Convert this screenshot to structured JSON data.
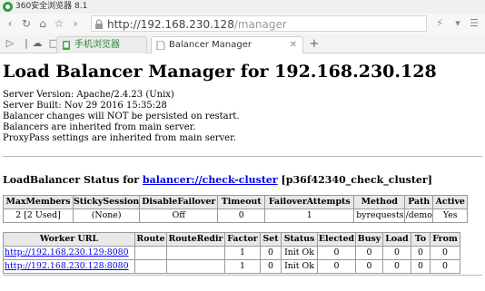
{
  "browser": {
    "app_title": "360安全浏览器 8.1",
    "url_host": "http://192.168.230.128",
    "url_path": "/manager",
    "tabs": [
      {
        "label": "手机浏览器",
        "active": false
      },
      {
        "label": "Balancer Manager",
        "active": true
      }
    ],
    "new_tab_label": "+"
  },
  "page": {
    "title": "Load Balancer Manager for 192.168.230.128",
    "info_lines": [
      "Server Version: Apache/2.4.23 (Unix)",
      "Server Built: Nov 29 2016 15:35:28",
      "Balancer changes will NOT be persisted on restart.",
      "Balancers are inherited from main server.",
      "ProxyPass settings are inherited from main server."
    ],
    "status": {
      "prefix": "LoadBalancer Status for",
      "link": "balancer://check-cluster",
      "suffix": "[p36f42340_check_cluster]"
    },
    "balancer_table": {
      "headers": [
        "MaxMembers",
        "StickySession",
        "DisableFailover",
        "Timeout",
        "FailoverAttempts",
        "Method",
        "Path",
        "Active"
      ],
      "row": [
        "2 [2 Used]",
        "(None)",
        "Off",
        "0",
        "1",
        "byrequests",
        "/demo",
        "Yes"
      ]
    },
    "worker_table": {
      "headers": [
        "Worker URL",
        "Route",
        "RouteRedir",
        "Factor",
        "Set",
        "Status",
        "Elected",
        "Busy",
        "Load",
        "To",
        "From"
      ],
      "rows": [
        [
          "http://192.168.230.129:8080",
          "",
          "",
          "1",
          "0",
          "Init Ok",
          "0",
          "0",
          "0",
          "0",
          "0"
        ],
        [
          "http://192.168.230.128:8080",
          "",
          "",
          "1",
          "0",
          "Init Ok",
          "0",
          "0",
          "0",
          "0",
          "0"
        ]
      ]
    }
  },
  "colors": {
    "link": "#0000ee",
    "header_bg": "#e8e8e8",
    "tab_active": "#ffffff"
  }
}
